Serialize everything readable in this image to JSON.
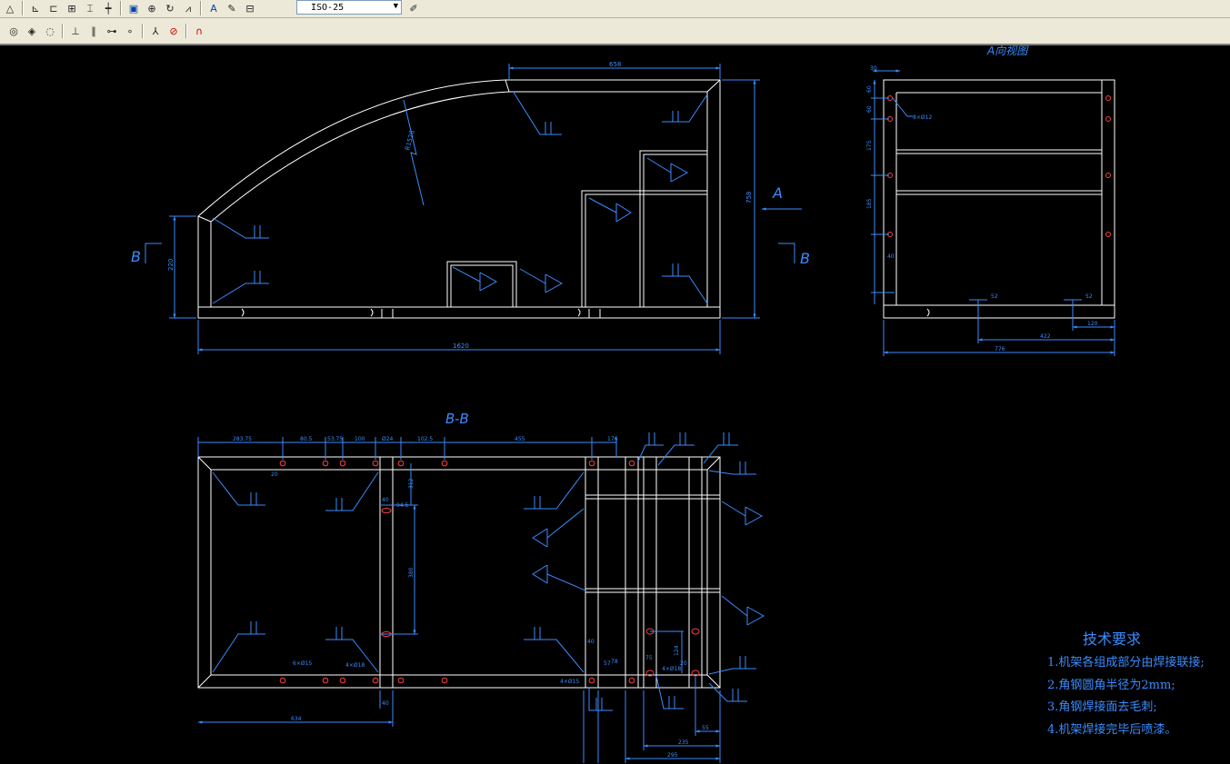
{
  "toolbar": {
    "row1_icons": [
      "angular-dimension-icon",
      "ordinate-dimension-icon",
      "baseline-dimension-icon",
      "continue-dimension-icon",
      "quick-leader-icon",
      "tolerance-icon",
      "center-mark-icon",
      "dimension-edit-icon",
      "dimension-text-edit-icon",
      "dimension-update-icon",
      "dimension-style-icon",
      "text-style-icon"
    ],
    "dim_style_value": "ISO-25",
    "row2_icons": [
      "snap-center-icon",
      "snap-quadrant-icon",
      "snap-tangent-icon",
      "snap-perpendicular-icon",
      "snap-parallel-icon",
      "snap-insert-icon",
      "snap-node-icon",
      "snap-nearest-icon",
      "snap-none-icon",
      "snap-settings-icon"
    ]
  },
  "drawing": {
    "view_a_label": "A向视图",
    "section_label": "B-B",
    "arrow_a": "A",
    "section_b_left": "B",
    "section_b_right": "B",
    "front": {
      "dim_top": "658",
      "dim_bottom": "1620",
      "dim_right_height": "758",
      "dim_left_height": "220",
      "dim_arc": "R1526"
    },
    "side": {
      "dim_top1": "30",
      "dim_left_values": [
        "60",
        "60",
        "175",
        "185",
        "40"
      ],
      "dim_hole": "8×Ø12",
      "dim_b1": "52",
      "dim_b2": "52",
      "dim_422": "422",
      "dim_120": "120",
      "dim_bottom": "776"
    },
    "bb": {
      "dims_top": [
        "283.75",
        "80.5",
        "53.75",
        "100",
        "Ø24",
        "102.5",
        "455",
        "176"
      ],
      "dim_left_offset": "20",
      "dim_small_1": "40",
      "dim_small_2": "94.5",
      "dim_vert_1": "312",
      "dim_vert_2": "380",
      "dim_hole_left": "6×Ø15",
      "dim_hole_mid": "4×Ø18",
      "dim_hole_right": "4×Ø15",
      "dim_hole_rb": "4×Ø18",
      "dim_bottom_left": "634",
      "dim_bottom_offset": "40",
      "dim_r_small": [
        "40",
        "57",
        "78",
        "75",
        "20"
      ],
      "dim_r_vert": "124",
      "dim_r_55": "55",
      "dim_r_235": "235",
      "dim_r_295": "295"
    }
  },
  "tech_requirements": {
    "title": "技术要求",
    "items": [
      "1.机架各组成部分由焊接联接;",
      "2.角钢圆角半径为2mm;",
      "3.角钢焊接面去毛刺;",
      "4.机架焊接完毕后喷漆。"
    ]
  },
  "colors": {
    "background": "#000000",
    "lines": "#ffffff",
    "dimensions": "#3a8cff",
    "holes": "#ff4040",
    "toolbar": "#ece9d8"
  }
}
